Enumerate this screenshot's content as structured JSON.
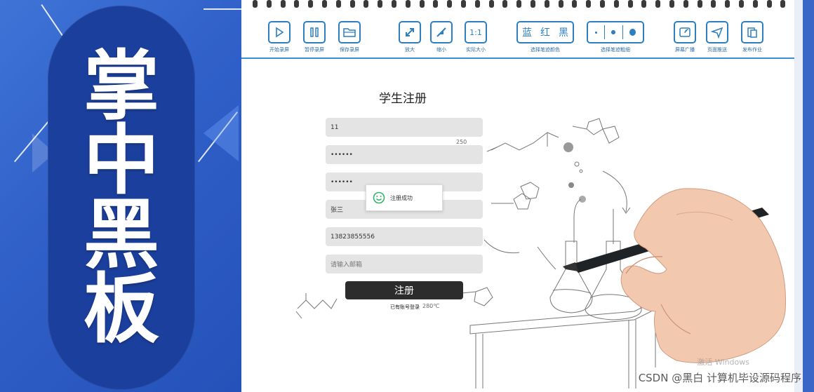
{
  "brand": {
    "chars": [
      "掌",
      "中",
      "黑",
      "板"
    ]
  },
  "toolbar": {
    "tools": [
      {
        "id": "start-record",
        "label": "开始录屏",
        "icon": "play-icon"
      },
      {
        "id": "pause-record",
        "label": "暂停录屏",
        "icon": "pause-icon"
      },
      {
        "id": "save-record",
        "label": "保存录屏",
        "icon": "folder-icon"
      },
      {
        "id": "zoom-in",
        "label": "放大",
        "icon": "expand-icon"
      },
      {
        "id": "zoom-out",
        "label": "缩小",
        "icon": "shrink-icon"
      },
      {
        "id": "actual-size",
        "label": "实际大小",
        "icon": "actual-size-icon",
        "text": "1:1"
      },
      {
        "id": "pen-color",
        "label": "选择笔迹颜色",
        "options": [
          "蓝",
          "红",
          "黑"
        ]
      },
      {
        "id": "pen-width",
        "label": "选择笔迹粗细"
      },
      {
        "id": "screen-broadcast",
        "label": "屏幕广播",
        "icon": "broadcast-icon"
      },
      {
        "id": "page-push",
        "label": "页面推送",
        "icon": "send-icon"
      },
      {
        "id": "publish-homework",
        "label": "发布作业",
        "icon": "homework-icon"
      }
    ]
  },
  "form": {
    "title": "学生注册",
    "fields": [
      {
        "name": "account-field",
        "value": "11",
        "placeholder": false
      },
      {
        "name": "password-field",
        "value": "••••••",
        "placeholder": false
      },
      {
        "name": "confirm-password-field",
        "value": "••••••",
        "placeholder": false
      },
      {
        "name": "name-field",
        "value": "张三",
        "placeholder": false
      },
      {
        "name": "phone-field",
        "value": "13823855556",
        "placeholder": false
      },
      {
        "name": "email-field",
        "value": "请输入邮箱",
        "placeholder": true
      }
    ],
    "submit_label": "注册",
    "login_link": "已有账号登录"
  },
  "toast": {
    "message": "注册成功"
  },
  "sketch_labels": {
    "temp": "280℃",
    "num": "250"
  },
  "watermark": {
    "windows": "激活 Windows",
    "csdn": "CSDN @黑白  计算机毕设源码程序"
  },
  "colors": {
    "brand_blue": "#2f5fc8",
    "capsule": "#1b3f9c",
    "toolbar_blue": "#2d7fc0"
  }
}
